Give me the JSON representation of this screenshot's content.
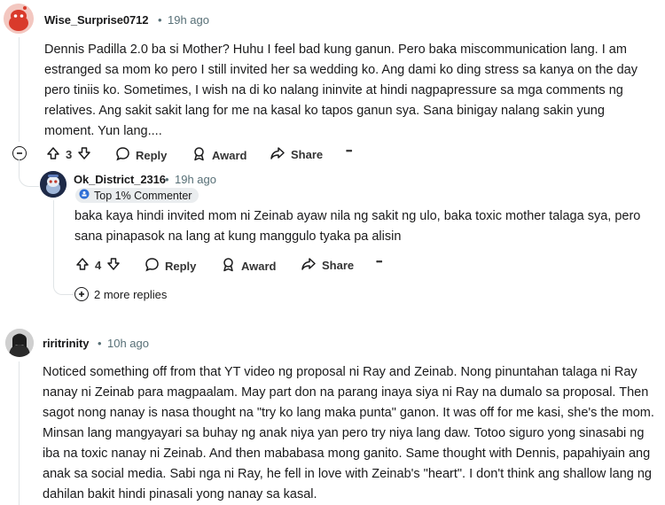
{
  "comments": [
    {
      "author": "Wise_Surprise0712",
      "separator": "•",
      "time": "19h ago",
      "body": "Dennis Padilla 2.0 ba si Mother? Huhu I feel bad kung ganun. Pero baka miscommunication lang. I am estranged sa mom ko pero I still invited her sa wedding ko. Ang dami ko ding stress sa kanya on the day pero tiniis ko. Sometimes, I wish na di ko nalang ininvite at hindi nagpapressure sa mga comments ng relatives. Ang sakit sakit lang for me na kasal ko tapos ganun sya. Sana binigay nalang sakin yung moment. Yun lang....",
      "votes": "3",
      "reply_label": "Reply",
      "award_label": "Award",
      "share_label": "Share",
      "more_label": "•••"
    },
    {
      "author": "Ok_District_2316",
      "separator": "•",
      "time": "19h ago",
      "badge": "Top 1% Commenter",
      "body": "baka kaya hindi invited mom ni Zeinab ayaw nila ng sakit ng ulo, baka toxic mother talaga sya, pero sana pinapasok na lang at kung manggulo tyaka pa alisin",
      "votes": "4",
      "reply_label": "Reply",
      "award_label": "Award",
      "share_label": "Share",
      "more_label": "•••",
      "more_replies": "2 more replies"
    },
    {
      "author": "riritrinity",
      "separator": "•",
      "time": "10h ago",
      "body": "Noticed something off from that YT video ng proposal ni Ray and Zeinab. Nong pinuntahan talaga ni Ray nanay ni Zeinab para magpaalam. May part don na parang inaya siya ni Ray na dumalo sa proposal. Then sagot nong nanay is nasa thought na \"try ko lang maka punta\" ganon. It was off for me kasi, she's the mom. Minsan lang mangyayari sa buhay ng anak niya yan pero try niya lang daw. Totoo siguro yong sinasabi ng iba na toxic nanay ni Zeinab. And then mababasa mong ganito. Same thought with Dennis, papahiyain ang anak sa social media. Sabi nga ni Ray, he fell in love with Zeinab's \"heart\". I don't think ang shallow lang ng dahilan bakit hindi pinasali yong nanay sa kasal."
    }
  ],
  "icons": {
    "collapse": "minus-circle-icon",
    "upvote": "arrow-up-icon",
    "downvote": "arrow-down-icon",
    "reply": "speech-bubble-icon",
    "award": "award-icon",
    "share": "share-arrow-icon",
    "expand": "plus-circle-icon"
  },
  "colors": {
    "meta": "#576f76",
    "thread_line": "#e0e4e6",
    "badge_bg": "#eaedef",
    "snoo_red": "#d93a2b",
    "badge_icon": "#2f6fd6"
  }
}
